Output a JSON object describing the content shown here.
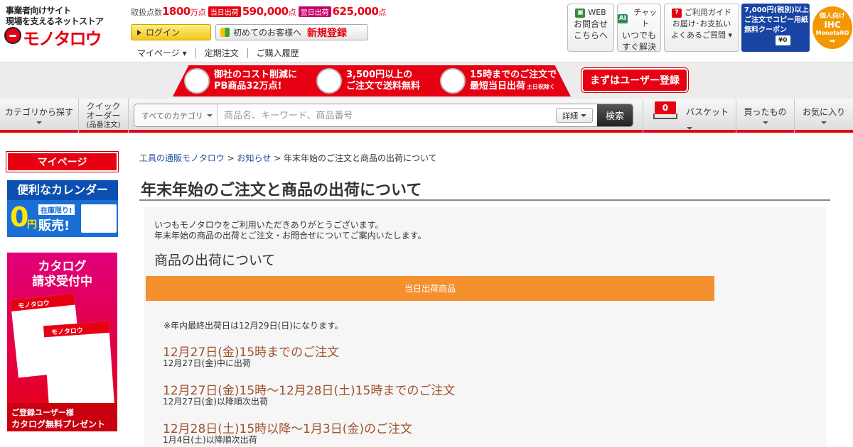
{
  "header": {
    "logo_tagline_1": "事業者向けサイト",
    "logo_tagline_2": "現場を支えるネットストア",
    "logo_name": "モノタロウ",
    "stats": {
      "label": "取扱点数",
      "total": "1800",
      "total_unit": "万点",
      "same_day_tag": "当日出荷",
      "same_day": "590,000",
      "same_day_unit": "点",
      "next_day_tag": "翌日出荷",
      "next_day": "625,000",
      "next_day_unit": "点"
    },
    "login_label": "ログイン",
    "new_customer_label": "初めてのお客様へ",
    "register_label": "新規登録",
    "subnav": [
      "マイページ ▾",
      "定期注文",
      "ご購入履歴"
    ],
    "boxes": [
      {
        "icon": "web-icon",
        "head": "WEB",
        "line1": "お問合せ",
        "line2": "こちらへ"
      },
      {
        "icon": "ai-chat-icon",
        "head": "チャット",
        "line1": "いつでも",
        "line2": "すぐ解決"
      },
      {
        "icon": "question-icon",
        "head": "ご利用ガイド",
        "line1": "お届け･お支払い",
        "line2": "よくあるご質問 ▾"
      }
    ],
    "coupon": {
      "line1": "7,000円(税別)以上の",
      "line2": "ご注文でコピー用紙",
      "line3": "無料クーポン",
      "price": "¥0"
    },
    "ihc": {
      "line1": "個人向け",
      "line2": "IHC",
      "line3": "MonotaRO"
    }
  },
  "banner": {
    "item1": {
      "line1": "御社のコスト削減に",
      "line2": "PB商品32万点!"
    },
    "item2": {
      "line1": "3,500円以上の",
      "line2": "ご注文で送料無料"
    },
    "item3": {
      "line1": "15時までのご注文で",
      "line2": "最短当日出荷",
      "note": "土日祝除く"
    },
    "cta": "まずはユーザー登録"
  },
  "nav": {
    "category": "カテゴリから探す",
    "quick_order_1": "クイック",
    "quick_order_2": "オーダー",
    "quick_order_3": "(品番注文)",
    "search_category": "すべてのカテゴリ",
    "search_placeholder": "商品名、キーワード、商品番号",
    "detail": "詳細",
    "search_button": "検索",
    "basket_count": "0",
    "basket": "バスケット",
    "bought": "買ったもの",
    "favorites": "お気に入り"
  },
  "sidebar": {
    "mypage": "マイページ",
    "calendar": {
      "line1": "便利なカレンダー",
      "tag": "在庫限り!",
      "price": "0",
      "unit": "円",
      "sale": "販売!"
    },
    "catalog": {
      "line1": "カタログ",
      "line2": "請求受付中",
      "brand": "モノタロウ",
      "foot1": "ご登録ユーザー様",
      "foot2": "カタログ無料プレゼント"
    }
  },
  "breadcrumb": {
    "home": "工具の通販モノタロウ",
    "sep1": ">",
    "news": "お知らせ",
    "sep2": ">",
    "current": "年末年始のご注文と商品の出荷について"
  },
  "page_title": "年末年始のご注文と商品の出荷について",
  "intro_1": "いつもモノタロウをご利用いただきありがとうございます。",
  "intro_2": "年末年始の商品の出荷とご注文・お問合せについてご案内いたします。",
  "section_title": "商品の出荷について",
  "tab_label": "当日出荷商品",
  "note": "※年内最終出荷日は12月29日(日)になります。",
  "schedule": [
    {
      "heading": "12月27日(金)15時までのご注文",
      "detail": "12月27日(金)中に出荷"
    },
    {
      "heading": "12月27日(金)15時～12月28日(土)15時までのご注文",
      "detail": "12月27日(金)以降順次出荷"
    },
    {
      "heading": "12月28日(土)15時以降～1月3日(金)のご注文",
      "detail": "1月4日(土)以降順次出荷"
    }
  ],
  "colors": {
    "brand_red": "#e60012",
    "orange": "#f5902f",
    "schedule_text": "#a0522d",
    "coupon_blue": "#1844a4"
  }
}
